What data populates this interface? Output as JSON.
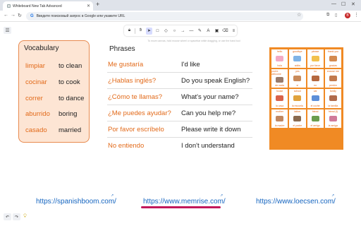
{
  "browser": {
    "tab_title": "Whiteboard New Tab Advanced",
    "address_placeholder": "Введите поисковый запрос в Google или укажите URL",
    "avatar_letter": "B"
  },
  "toolbar": {
    "tools": [
      "lock",
      "hand",
      "select",
      "rectangle",
      "ellipse",
      "diamond",
      "arrow",
      "line",
      "pencil",
      "text",
      "image",
      "eraser",
      "more"
    ],
    "hint": "To move canvas, hold mouse wheel or spacebar while dragging, or use the hand tool"
  },
  "vocabulary": {
    "title": "Vocabulary",
    "items": [
      {
        "es": "limpiar",
        "en": "to clean"
      },
      {
        "es": "cocinar",
        "en": "to cook"
      },
      {
        "es": "correr",
        "en": "to dance"
      },
      {
        "es": "aburrido",
        "en": "boring"
      },
      {
        "es": "casado",
        "en": "married"
      }
    ]
  },
  "phrases": {
    "title": "Phrases",
    "items": [
      {
        "es": "Me gustaría",
        "en": "I'd like"
      },
      {
        "es": "¿Hablas inglés?",
        "en": "Do you speak English?"
      },
      {
        "es": "¿Cómo te llamas?",
        "en": "What's your name?"
      },
      {
        "es": "¿Me puedes ayudar?",
        "en": "Can you help me?"
      },
      {
        "es": "Por favor escríbelo",
        "en": "Please write it down"
      },
      {
        "es": "No entiendo",
        "en": "I don't understand"
      }
    ]
  },
  "picture_grid": {
    "cells": [
      {
        "top": "hello",
        "bottom": "hola",
        "color": "#f3a9c4"
      },
      {
        "top": "goodbye",
        "bottom": "adiós",
        "color": "#7fb3e6"
      },
      {
        "top": "please",
        "bottom": "por favor",
        "color": "#f2c14e"
      },
      {
        "top": "thank you",
        "bottom": "gracias",
        "color": "#d48a4f"
      },
      {
        "top": "you're welcome",
        "bottom": "de nada",
        "color": "#9a7b6a"
      },
      {
        "top": "yes",
        "bottom": "sí",
        "color": "#c98a5a"
      },
      {
        "top": "no",
        "bottom": "no",
        "color": "#b5683f"
      },
      {
        "top": "excuse me",
        "bottom": "perdón",
        "color": "#c27a4d"
      },
      {
        "top": "house",
        "bottom": "la casa",
        "color": "#d9624a"
      },
      {
        "top": "school",
        "bottom": "la escuela",
        "color": "#e0a23d"
      },
      {
        "top": "car",
        "bottom": "el coche",
        "color": "#5d8fd8"
      },
      {
        "top": "family",
        "bottom": "la familia",
        "color": "#b06b4c"
      },
      {
        "top": "mother",
        "bottom": "la madre",
        "color": "#c1865f"
      },
      {
        "top": "father",
        "bottom": "el padre",
        "color": "#8a6a4f"
      },
      {
        "top": "friend",
        "bottom": "el amigo",
        "color": "#6b9d4e"
      },
      {
        "top": "friend (f)",
        "bottom": "la amiga",
        "color": "#d07a9a"
      }
    ]
  },
  "links": [
    {
      "text": "https://spanishboom.com/"
    },
    {
      "text": "https://www.memrise.com/"
    },
    {
      "text": "https://www.loecsen.com/"
    }
  ]
}
